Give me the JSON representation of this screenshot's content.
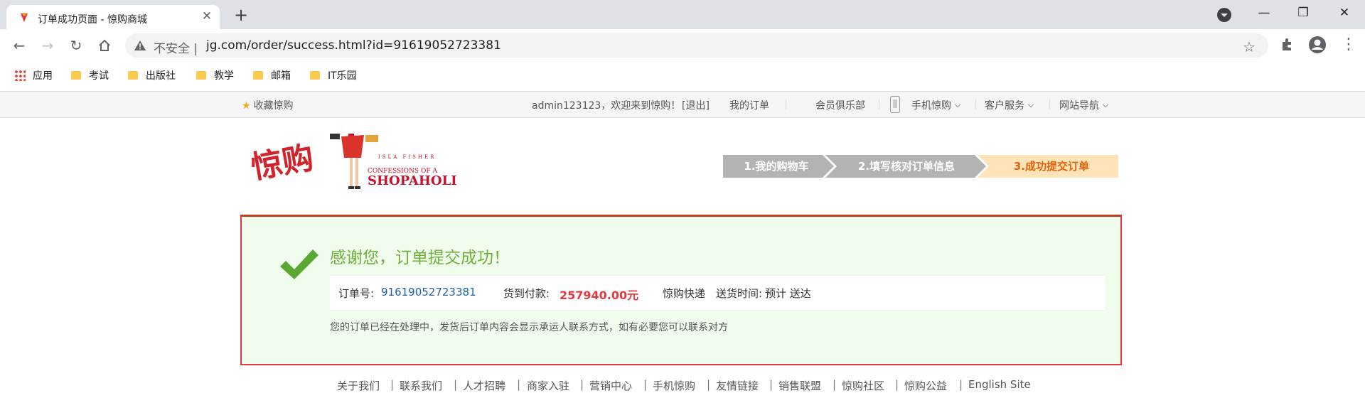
{
  "browser": {
    "tab_title": "订单成功页面 - 惊购商城",
    "insecure_label": "不安全",
    "url": "jg.com/order/success.html?id=91619052723381",
    "bookmarks": [
      "应用",
      "考试",
      "出版社",
      "教学",
      "邮箱",
      "IT乐园"
    ]
  },
  "topbar": {
    "favorite": "收藏惊购",
    "welcome": "admin123123，欢迎来到惊购！",
    "logout": "[退出]",
    "my_orders": "我的订单",
    "member_club": "会员俱乐部",
    "mobile": "手机惊购",
    "service": "客户服务",
    "site_nav": "网站导航"
  },
  "logo": {
    "brand": "惊购",
    "line1": "ISLA FISHER",
    "line2": "CONFESSIONS OF A",
    "line3": "SHOPAHOLIC"
  },
  "steps": [
    {
      "label": "1.我的购物车",
      "state": "done"
    },
    {
      "label": "2.填写核对订单信息",
      "state": "done"
    },
    {
      "label": "3.成功提交订单",
      "state": "current"
    }
  ],
  "success": {
    "title": "感谢您，订单提交成功！",
    "order_no_label": "订单号:",
    "order_no": "91619052723381",
    "pay_label": "货到付款:",
    "amount": "257940.00元",
    "carrier": "惊购快递",
    "delivery_label": "送货时间:",
    "delivery_value": "预计 送达",
    "note": "您的订单已经在处理中，发货后订单内容会显示承运人联系方式，如有必要您可以联系对方"
  },
  "footer": {
    "links": [
      "关于我们",
      "联系我们",
      "人才招聘",
      "商家入驻",
      "营销中心",
      "手机惊购",
      "友情链接",
      "销售联盟",
      "惊购社区",
      "惊购公益",
      "English Site"
    ],
    "separator": "|"
  },
  "colors": {
    "step_done": "#b3b3b3",
    "step_current": "#ffe3b9",
    "step_current_text": "#e4630c",
    "success_green": "#6fb13a",
    "amount_red": "#e4393c",
    "box_border": "#e4393c",
    "box_bg": "#f0fcec"
  }
}
